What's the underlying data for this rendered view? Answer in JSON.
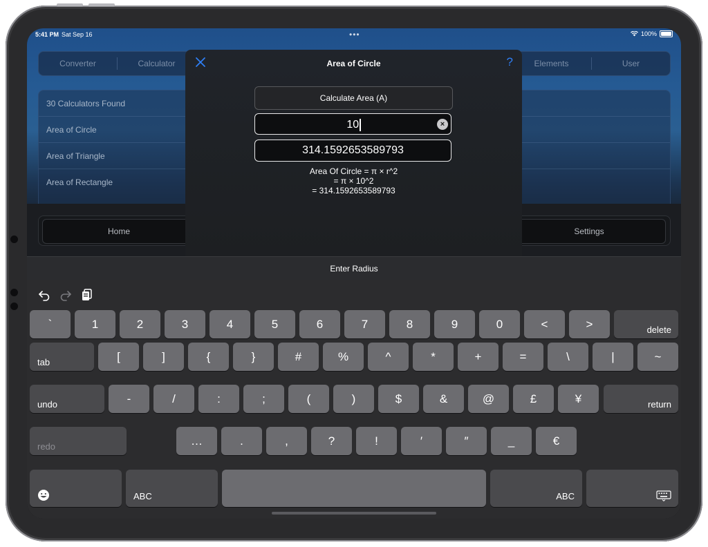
{
  "status_bar": {
    "time": "5:41 PM",
    "date": "Sat Sep 16",
    "battery": "100%"
  },
  "tabs": [
    "Converter",
    "Calculator",
    "Elements",
    "User"
  ],
  "list": {
    "rows": [
      "30 Calculators Found",
      "Area of Circle",
      "Area of Triangle",
      "Area of Rectangle"
    ]
  },
  "bottom_nav": [
    "Home",
    "Settings"
  ],
  "modal": {
    "title": "Area of Circle",
    "help": "?",
    "calc_button": "Calculate Area (A)",
    "input_value": "10",
    "result": "314.1592653589793",
    "formula": [
      "Area Of Circle = π × r^2",
      "=  π × 10^2",
      "= 314.1592653589793"
    ]
  },
  "accessory_label": "Enter Radius",
  "keyboard": {
    "row1": [
      "`",
      "1",
      "2",
      "3",
      "4",
      "5",
      "6",
      "7",
      "8",
      "9",
      "0",
      "<",
      ">"
    ],
    "row1_end": "delete",
    "row2_start": "tab",
    "row2": [
      "[",
      "]",
      "{",
      "}",
      "#",
      "%",
      "^",
      "*",
      "+",
      "=",
      "\\",
      "|",
      "~"
    ],
    "row3_start": "undo",
    "row3": [
      "-",
      "/",
      ":",
      ";",
      "(",
      ")",
      "$",
      "&",
      "@",
      "£",
      "¥"
    ],
    "row3_end": "return",
    "row4_start": "redo",
    "row4": [
      "…",
      ".",
      ",",
      "?",
      "!",
      "′",
      "″",
      "_",
      "€"
    ],
    "row5_left": "ABC",
    "row5_right": "ABC"
  },
  "colors": {
    "accent": "#2f7ff5",
    "key": "#6c6c70",
    "key_dark": "#4a4a4d",
    "keyboard_bg": "#2c2c2e"
  }
}
